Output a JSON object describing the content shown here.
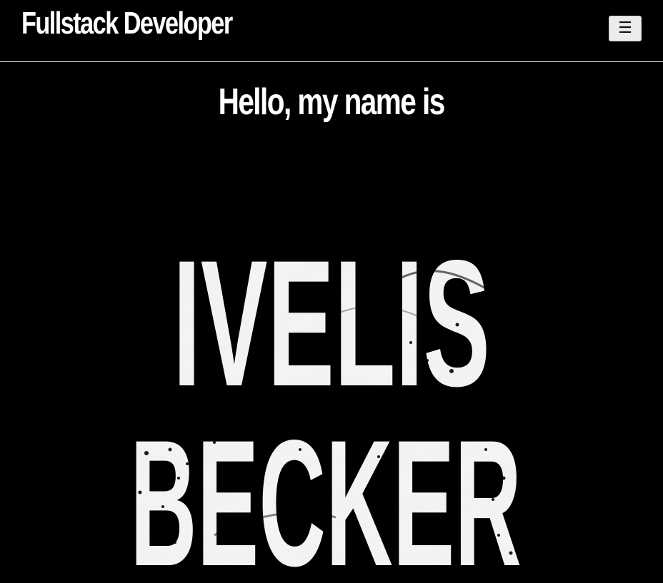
{
  "navbar": {
    "brand": "Fullstack Developer",
    "menu_icon": "hamburger-menu-icon",
    "menu_glyph": "☰"
  },
  "hero": {
    "greeting": "Hello, my name is",
    "first_name": "IVELIS",
    "last_name": "BECKER"
  },
  "colors": {
    "background": "#000000",
    "text": "#ffffff",
    "divider": "#d8d8d8",
    "button_bg": "#ececec"
  }
}
